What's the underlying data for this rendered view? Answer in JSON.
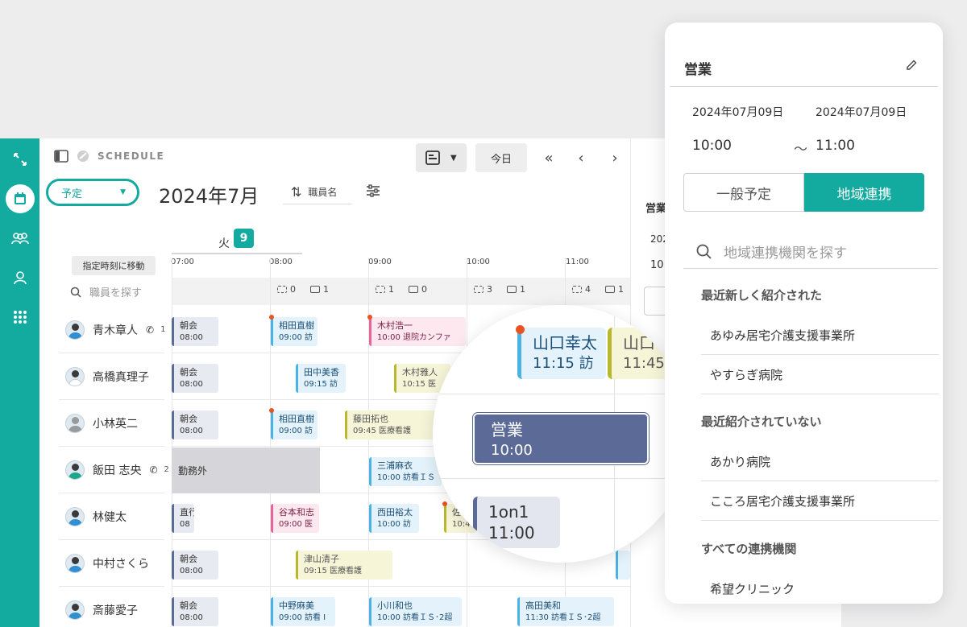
{
  "app": {
    "brand": "SCHEDULE",
    "today_label": "今日",
    "select_value": "予定",
    "month_title": "2024年7月",
    "sort_label": "職員名",
    "day_weekday": "火",
    "day_number": "9",
    "jump_label": "指定時刻に移動",
    "staff_search_placeholder": "職員を探す"
  },
  "hours": [
    "07:00",
    "08:00",
    "09:00",
    "10:00",
    "11:00"
  ],
  "counts": [
    {
      "a": "0",
      "b": "1"
    },
    {
      "a": "1",
      "b": "0"
    },
    {
      "a": "3",
      "b": "1"
    },
    {
      "a": "4",
      "b": "1"
    }
  ],
  "staff": [
    {
      "name": "青木章人",
      "phone": "1"
    },
    {
      "name": "高橋真理子",
      "phone": ""
    },
    {
      "name": "小林英二",
      "phone": ""
    },
    {
      "name": "飯田 志央",
      "phone": "2"
    },
    {
      "name": "林健太",
      "phone": ""
    },
    {
      "name": "中村さくら",
      "phone": ""
    },
    {
      "name": "斎藤愛子",
      "phone": ""
    }
  ],
  "offwork_label": "勤務外",
  "events": [
    {
      "l1": "朝会",
      "l2": "08:00"
    },
    {
      "l1": "相田直樹",
      "l2": "09:00 訪"
    },
    {
      "l1": "木村浩一",
      "l2": "10:00 退院カンファ"
    },
    {
      "l1": "朝会",
      "l2": "08:00"
    },
    {
      "l1": "田中美香",
      "l2": "09:15 訪"
    },
    {
      "l1": "木村雅人",
      "l2": "10:15 医"
    },
    {
      "l1": "朝会",
      "l2": "08:00"
    },
    {
      "l1": "相田直樹",
      "l2": "09:00 訪"
    },
    {
      "l1": "藤田拓也",
      "l2": "09:45 医療看護"
    },
    {
      "l1": "三浦麻衣",
      "l2": "10:00 訪看ＩＳ"
    },
    {
      "l1": "直行",
      "l2": "08"
    },
    {
      "l1": "谷本和志",
      "l2": "09:00 医"
    },
    {
      "l1": "西田裕太",
      "l2": "10:00 訪"
    },
    {
      "l1": "佐",
      "l2": "10:4"
    },
    {
      "l1": "朝会",
      "l2": "08:00"
    },
    {
      "l1": "津山清子",
      "l2": "09:15 医療看護"
    },
    {
      "l1": "朝会",
      "l2": "08:00"
    },
    {
      "l1": "中野麻美",
      "l2": "09:00 訪看 I"
    },
    {
      "l1": "小川和也",
      "l2": "10:00 訪看ＩＳ･2超"
    },
    {
      "l1": "高田美和",
      "l2": "11:30 訪看ＩＳ･2超"
    }
  ],
  "magnifier": {
    "e1_name": "山口幸太",
    "e1_time": "11:15 訪",
    "e2_name": "山口",
    "e2_time": "11:45",
    "e3_name": "営業",
    "e3_time": "10:00",
    "e4_name": "1on1",
    "e4_time": "11:00"
  },
  "side": {
    "t1": "営業",
    "t2": "202",
    "t3": "10"
  },
  "panel": {
    "title": "営業",
    "start_date": "2024年07月09日",
    "end_date": "2024年07月09日",
    "start_time": "10:00",
    "tilde": "〜",
    "end_time": "11:00",
    "tab_general": "一般予定",
    "tab_regional": "地域連携",
    "search_placeholder": "地域連携機関を探す",
    "section_recent": "最近新しく紹介された",
    "recent_items": [
      "あゆみ居宅介護支援事業所",
      "やすらぎ病院"
    ],
    "section_not_recent": "最近紹介されていない",
    "not_recent_items": [
      "あかり病院",
      "こころ居宅介護支援事業所"
    ],
    "section_all": "すべての連携機関",
    "all_items": [
      "希望クリニック"
    ]
  },
  "colors": {
    "accent": "#13aaa0",
    "event_navy": "#5b6a96",
    "event_blue": "#4ab2e4",
    "event_pink": "#e5659a",
    "event_olive": "#b8b82e",
    "marker": "#e95322"
  }
}
